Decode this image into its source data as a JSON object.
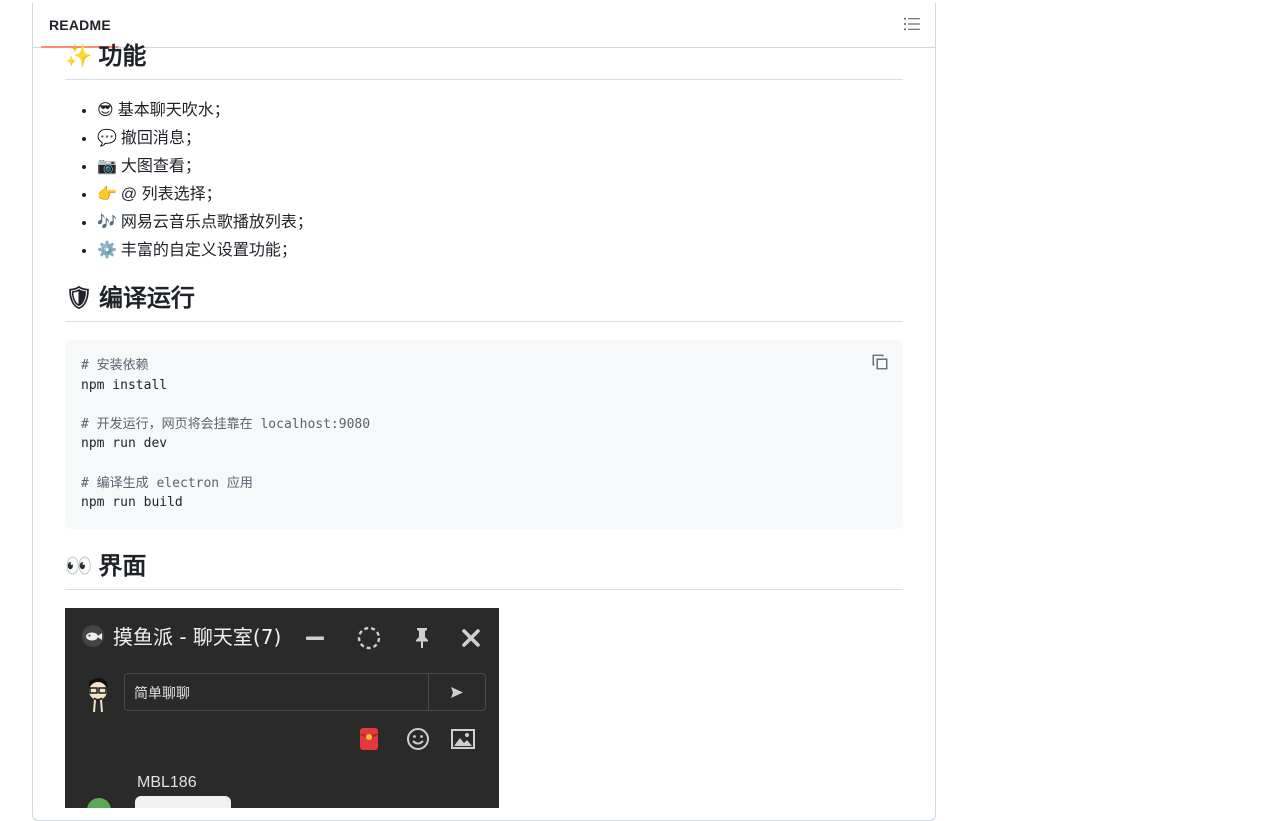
{
  "readme": {
    "tab_label": "README",
    "outline_icon": "list-unordered-icon"
  },
  "features": {
    "heading_emoji": "✨",
    "heading": "功能",
    "items": [
      {
        "emoji": "😎",
        "text": "基本聊天吹水；"
      },
      {
        "emoji": "💬",
        "text": "撤回消息；"
      },
      {
        "emoji": "📷",
        "text": "大图查看；"
      },
      {
        "emoji": "👉",
        "text": "@ 列表选择；"
      },
      {
        "emoji": "🎶",
        "text": "网易云音乐点歌播放列表；"
      },
      {
        "emoji": "⚙️",
        "text": "丰富的自定义设置功能；"
      }
    ]
  },
  "build": {
    "heading_emoji": "🛡",
    "heading": "编译运行",
    "code_lines": [
      {
        "text": "# 安装依赖",
        "comment": true
      },
      {
        "text": "npm install",
        "comment": false
      },
      {
        "text": "",
        "comment": false
      },
      {
        "text": "# 开发运行，网页将会挂靠在 localhost:9080",
        "comment": true
      },
      {
        "text": "npm run dev",
        "comment": false
      },
      {
        "text": "",
        "comment": false
      },
      {
        "text": "# 编译生成 electron 应用",
        "comment": true
      },
      {
        "text": "npm run build",
        "comment": false
      }
    ],
    "copy_icon": "copy-icon"
  },
  "ui": {
    "heading_emoji": "👀",
    "heading": "界面",
    "screenshot": {
      "title": "摸鱼派 - 聊天室(7)",
      "input_value": "简单聊聊",
      "username": "MBL186",
      "colors": {
        "background": "#2a2a2a",
        "red_packet": "#e4393c"
      }
    }
  }
}
